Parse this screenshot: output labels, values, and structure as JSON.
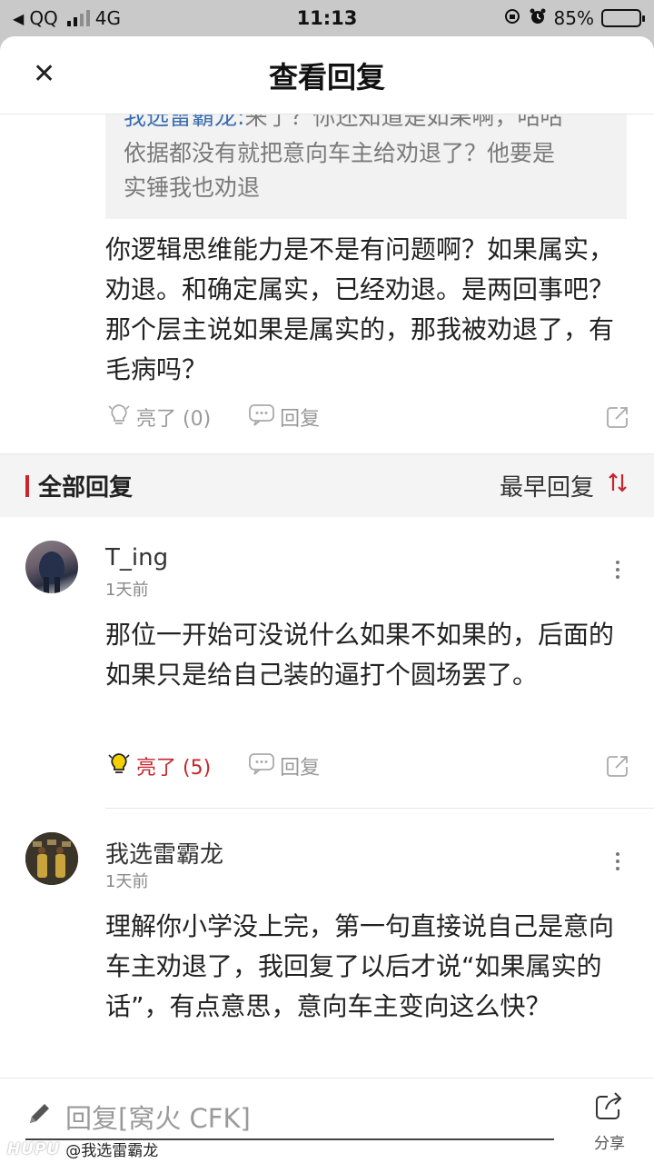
{
  "status_bar": {
    "back_app": "QQ",
    "network": "4G",
    "time": "11:13",
    "battery_pct": "85%",
    "battery_level": 0.85,
    "colors": {
      "battery_fill": "#3ec54a"
    }
  },
  "header": {
    "title": "查看回复",
    "close_icon": "close-icon"
  },
  "quoted_reply": {
    "author": "我选雷霸龙:",
    "first_line": "来了？你还知道是如果啊，咕咕",
    "line2": "依据都没有就把意向车主给劝退了？他要是",
    "line3": "实锤我也劝退"
  },
  "main_reply": {
    "text": "你逻辑思维能力是不是有问题啊？如果属实，劝退。和确定属实，已经劝退。是两回事吧？那个层主说如果是属实的，那我被劝退了，有毛病吗？",
    "like_label": "亮了 (0)",
    "reply_label": "回复"
  },
  "section": {
    "title": "全部回复",
    "sort_label": "最早回复"
  },
  "comments": [
    {
      "username": "T_ing",
      "time": "1天前",
      "text": "那位一开始可没说什么如果不如果的，后面的如果只是给自己装的逼打个圆场罢了。",
      "like_label": "亮了 (5)",
      "reply_label": "回复"
    },
    {
      "username": "我选雷霸龙",
      "time": "1天前",
      "text": "理解你小学没上完，第一句直接说自己是意向车主劝退了，我回复了以后才说“如果属实的话”，有点意思，意向车主变向这么快？"
    }
  ],
  "bottom_bar": {
    "reply_placeholder": "回复[窝火 CFK]",
    "share_label": "分享"
  },
  "watermark": {
    "logo": "HUPU",
    "handle": "@我选雷霸龙"
  },
  "colors": {
    "accent_red": "#c7252b",
    "link_blue": "#3b6fb0",
    "like_yellow": "#f5d000"
  }
}
